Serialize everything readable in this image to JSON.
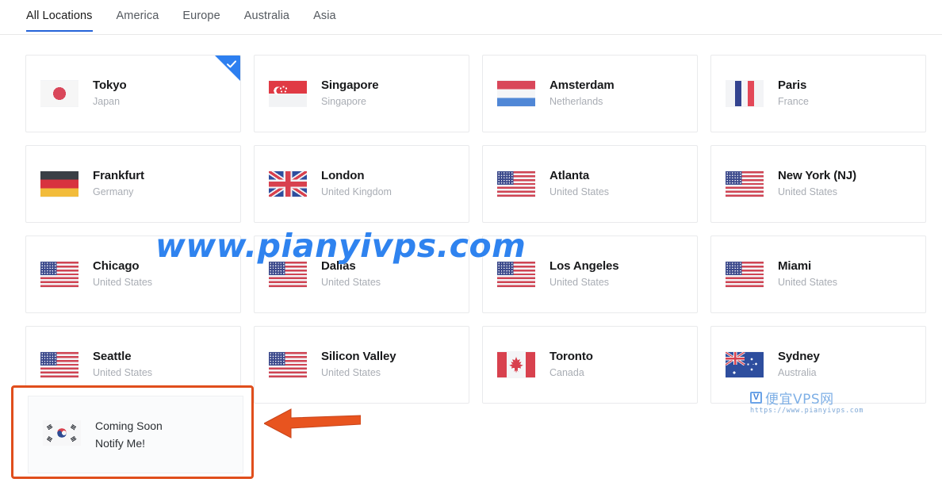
{
  "tabs": [
    {
      "label": "All Locations",
      "active": true
    },
    {
      "label": "America",
      "active": false
    },
    {
      "label": "Europe",
      "active": false
    },
    {
      "label": "Australia",
      "active": false
    },
    {
      "label": "Asia",
      "active": false
    }
  ],
  "locations": [
    {
      "city": "Tokyo",
      "country": "Japan",
      "flag": "jp",
      "selected": true
    },
    {
      "city": "Singapore",
      "country": "Singapore",
      "flag": "sg",
      "selected": false
    },
    {
      "city": "Amsterdam",
      "country": "Netherlands",
      "flag": "nl",
      "selected": false
    },
    {
      "city": "Paris",
      "country": "France",
      "flag": "fr",
      "selected": false
    },
    {
      "city": "Frankfurt",
      "country": "Germany",
      "flag": "de",
      "selected": false
    },
    {
      "city": "London",
      "country": "United Kingdom",
      "flag": "gb",
      "selected": false
    },
    {
      "city": "Atlanta",
      "country": "United States",
      "flag": "us",
      "selected": false
    },
    {
      "city": "New York (NJ)",
      "country": "United States",
      "flag": "us",
      "selected": false
    },
    {
      "city": "Chicago",
      "country": "United States",
      "flag": "us",
      "selected": false
    },
    {
      "city": "Dallas",
      "country": "United States",
      "flag": "us",
      "selected": false
    },
    {
      "city": "Los Angeles",
      "country": "United States",
      "flag": "us",
      "selected": false
    },
    {
      "city": "Miami",
      "country": "United States",
      "flag": "us",
      "selected": false
    },
    {
      "city": "Seattle",
      "country": "United States",
      "flag": "us",
      "selected": false
    },
    {
      "city": "Silicon Valley",
      "country": "United States",
      "flag": "us",
      "selected": false
    },
    {
      "city": "Toronto",
      "country": "Canada",
      "flag": "ca",
      "selected": false
    },
    {
      "city": "Sydney",
      "country": "Australia",
      "flag": "au",
      "selected": false
    }
  ],
  "coming_soon": {
    "flag": "kr",
    "line1": "Coming Soon",
    "line2": "Notify Me!"
  },
  "annotations": {
    "highlight_color": "#e04e1c",
    "arrow_color": "#e8541f",
    "arrow_direction": "left"
  },
  "watermark": {
    "text": "www.pianyivps.com",
    "text_color": "#2f83ef",
    "logo_mark": "V",
    "logo_text": "便宜VPS网",
    "logo_url": "https://www.pianyivps.com",
    "logo_color": "#7fb0e6"
  },
  "theme": {
    "accent": "#2563d9",
    "selected_badge": "#2d7ff0",
    "card_border": "#e9eaec",
    "city_text": "#18191b",
    "country_text": "#a9adb4"
  }
}
